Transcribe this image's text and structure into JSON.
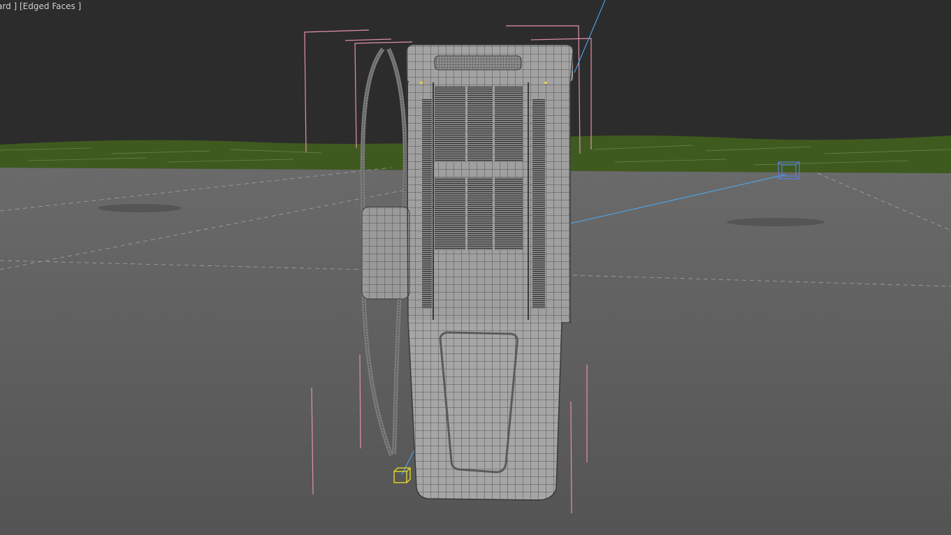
{
  "viewport": {
    "label": "ard ] [Edged Faces ]",
    "colors": {
      "sky": "#2c2c2c",
      "grass": "#3f5a1e",
      "ground": "#5c5c5c",
      "model": "#9a9a9a",
      "wire": "#3a3a3a",
      "selection_bracket": "#e58fb0",
      "light_line": "#4aa8f0",
      "target_helper": "#f0e020",
      "camera_helper": "#5a7fd8"
    }
  }
}
